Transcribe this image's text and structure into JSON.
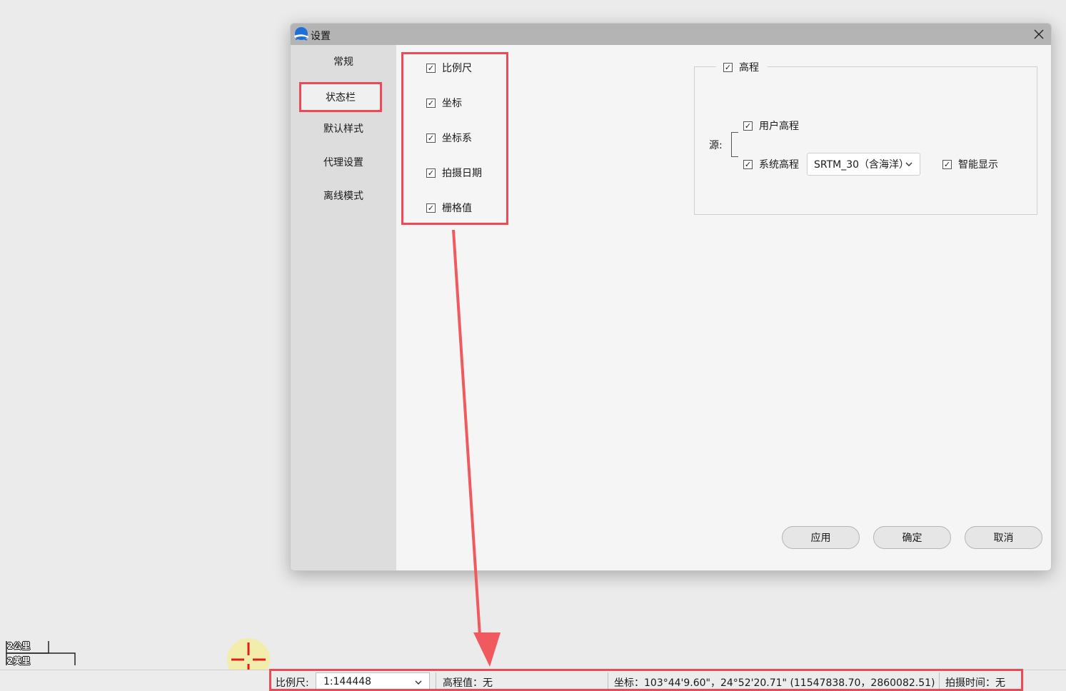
{
  "dialog": {
    "title": "设置",
    "nav": [
      "常规",
      "状态栏",
      "默认样式",
      "代理设置",
      "离线模式"
    ],
    "status_checkboxes": [
      {
        "label": "比例尺",
        "checked": true
      },
      {
        "label": "坐标",
        "checked": true
      },
      {
        "label": "坐标系",
        "checked": true
      },
      {
        "label": "拍摄日期",
        "checked": true
      },
      {
        "label": "栅格值",
        "checked": true
      }
    ],
    "elevation": {
      "group_label": "高程",
      "source_label": "源:",
      "user_elevation": "用户高程",
      "system_elevation": "系统高程",
      "dem_select": "SRTM_30（含海洋）",
      "smart_display": "智能显示"
    },
    "buttons": {
      "apply": "应用",
      "ok": "确定",
      "cancel": "取消"
    }
  },
  "map": {
    "scale_km": "2公里",
    "scale_mi": "2英里"
  },
  "statusbar": {
    "scale_label": "比例尺:",
    "scale_value": "1:144448",
    "elevation": "高程值：无",
    "coords": "坐标：103°44'9.60\"，24°52'20.71\"    (11547838.70，2860082.51)",
    "capture_time": "拍摄时间：无"
  },
  "colors": {
    "highlight": "#ee4a55",
    "arrow": "#f05a5e",
    "titlebar": "#b4b4b4",
    "sidebar": "#dddddd",
    "dialog_bg": "#f5f5f5"
  },
  "icons": [
    "app-logo-icon",
    "close-icon",
    "checkbox-check-icon",
    "chevron-down-icon",
    "crosshair-icon",
    "annotation-arrow"
  ]
}
